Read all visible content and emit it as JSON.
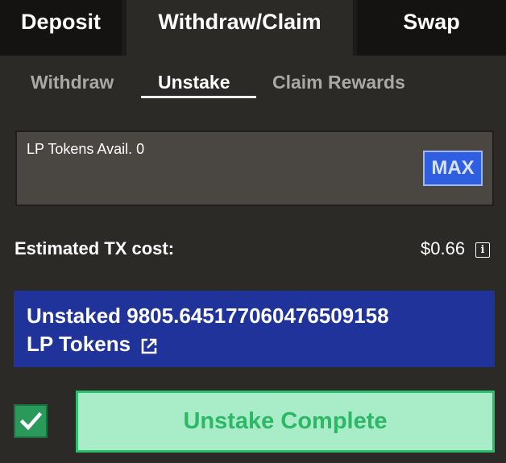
{
  "top_tabs": [
    {
      "label": "Deposit",
      "active": false
    },
    {
      "label": "Withdraw/Claim",
      "active": true
    },
    {
      "label": "Swap",
      "active": false
    }
  ],
  "sub_tabs": [
    {
      "label": "Withdraw",
      "active": false
    },
    {
      "label": "Unstake",
      "active": true
    },
    {
      "label": "Claim Rewards",
      "active": false
    }
  ],
  "token_input": {
    "avail_label": "LP Tokens Avail. 0",
    "max_label": "MAX"
  },
  "tx": {
    "label": "Estimated TX cost:",
    "value": "$0.66",
    "info_glyph": "i"
  },
  "status": {
    "line1": "Unstaked 9805.645177060476509158",
    "line2": "LP Tokens",
    "link_icon": "external-link-icon"
  },
  "action": {
    "checked": true,
    "button_label": "Unstake Complete"
  },
  "colors": {
    "background": "#2b2a27",
    "status_banner": "#20339a",
    "max_button": "#2f5fe0",
    "complete_button": "#a8ecc8",
    "complete_text": "#2cb866",
    "check_box": "#2a9a5a"
  }
}
